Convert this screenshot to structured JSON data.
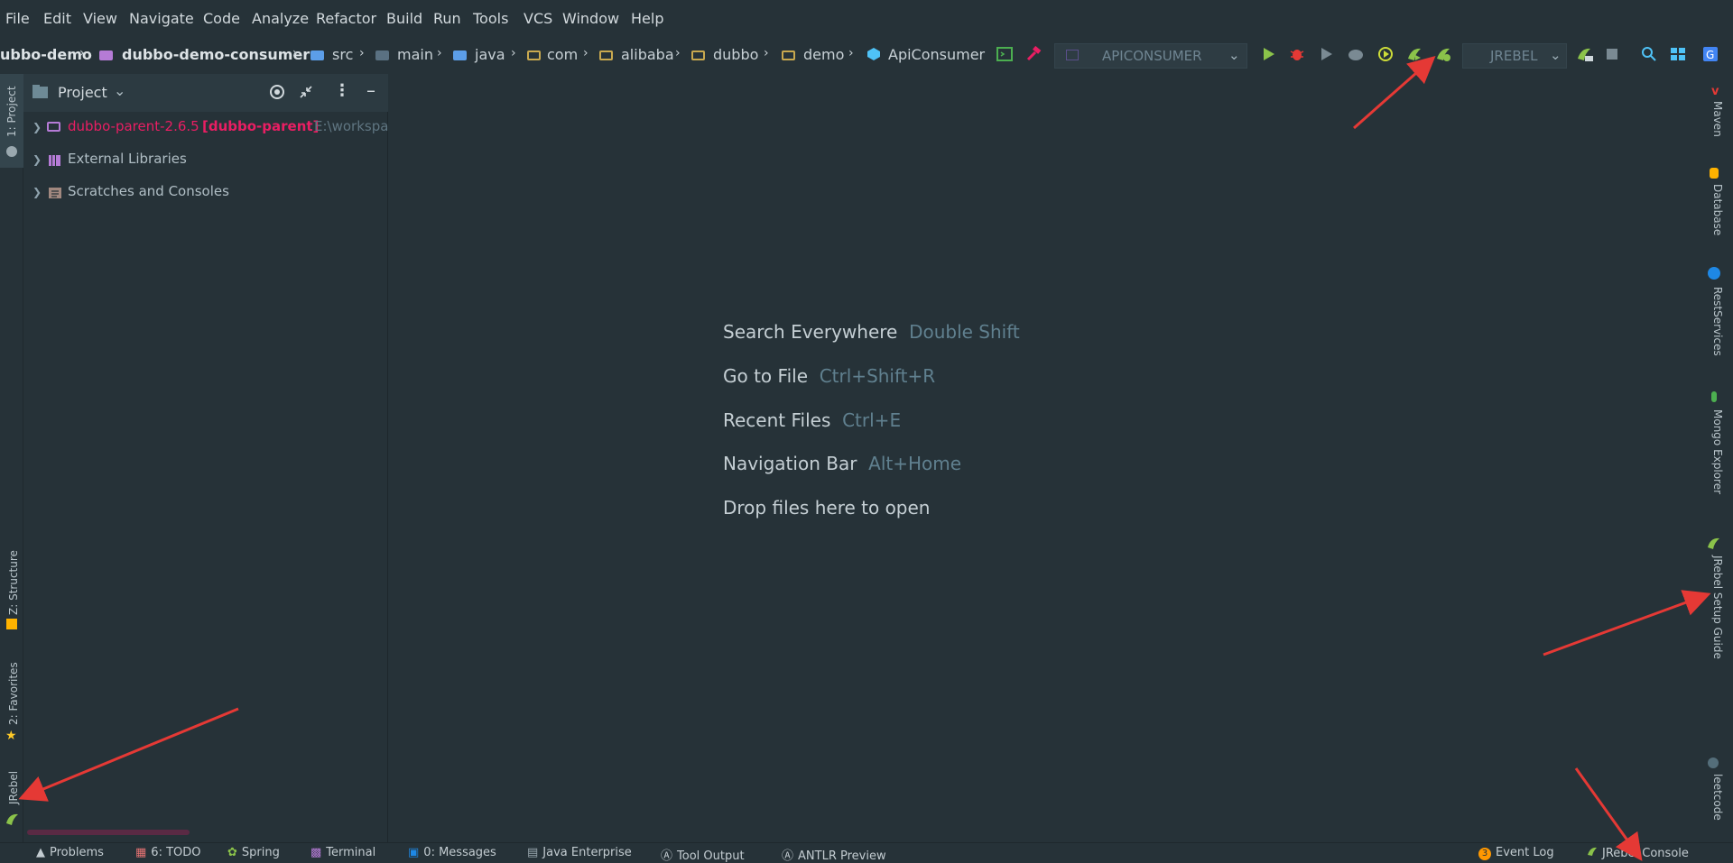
{
  "menu": [
    "File",
    "Edit",
    "View",
    "Navigate",
    "Code",
    "Analyze",
    "Refactor",
    "Build",
    "Run",
    "Tools",
    "VCS",
    "Window",
    "Help"
  ],
  "breadcrumbs": [
    "ubbo-demo",
    "dubbo-demo-consumer",
    "src",
    "main",
    "java",
    "com",
    "alibaba",
    "dubbo",
    "demo",
    "ApiConsumer"
  ],
  "toolbar": {
    "run_config": "APICONSUMER",
    "jrebel_config": "JREBEL"
  },
  "project_panel": {
    "title": "Project",
    "tree": [
      {
        "label": "dubbo-parent-2.6.5",
        "module": "[dubbo-parent]",
        "path": "E:\\workspac"
      },
      {
        "label": "External Libraries"
      },
      {
        "label": "Scratches and Consoles"
      }
    ]
  },
  "left_tabs": {
    "project": "1: Project",
    "structure": "Z: Structure",
    "favorites": "2: Favorites",
    "jrebel": "JRebel"
  },
  "right_tabs": [
    "Maven",
    "Database",
    "RestServices",
    "Mongo Explorer",
    "JRebel Setup Guide",
    "leetcode"
  ],
  "editor_hints": [
    {
      "label": "Search Everywhere",
      "key": "Double Shift"
    },
    {
      "label": "Go to File",
      "key": "Ctrl+Shift+R"
    },
    {
      "label": "Recent Files",
      "key": "Ctrl+E"
    },
    {
      "label": "Navigation Bar",
      "key": "Alt+Home"
    },
    {
      "label": "Drop files here to open",
      "key": ""
    }
  ],
  "status_bar": {
    "left": [
      "Problems",
      "6: TODO",
      "Spring",
      "Terminal",
      "0: Messages",
      "Java Enterprise",
      "Tool Output",
      "ANTLR Preview"
    ],
    "event_log": "Event Log",
    "event_count": "3",
    "jrebel_console": "JRebel Console"
  },
  "colors": {
    "background": "#263238",
    "accent_red": "#e53935",
    "module_pink": "#e91e63",
    "hint_key": "#60808f"
  }
}
